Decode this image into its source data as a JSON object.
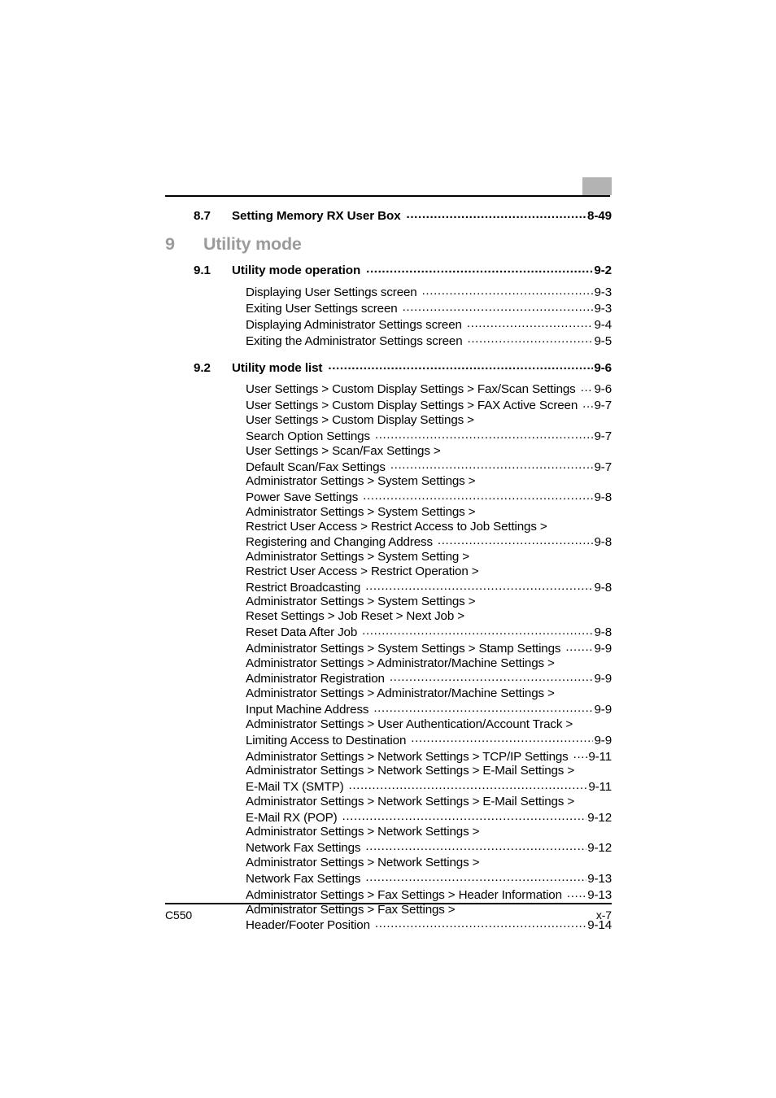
{
  "document": {
    "footer_left": "C550",
    "footer_right": "x-7",
    "tab_color": "#b3b3b3",
    "chapter_heading_color": "#9b9b9b"
  },
  "toc": {
    "prev_chapter_entry": {
      "number": "8.7",
      "label": "Setting Memory RX User Box",
      "page": "8-49"
    },
    "chapter": {
      "number": "9",
      "title": "Utility mode"
    },
    "sections": [
      {
        "number": "9.1",
        "label": "Utility mode operation",
        "page": "9-2",
        "entries": [
          {
            "lines": [
              "Displaying User Settings screen"
            ],
            "page": "9-3"
          },
          {
            "lines": [
              "Exiting User Settings screen"
            ],
            "page": "9-3"
          },
          {
            "lines": [
              "Displaying Administrator Settings screen"
            ],
            "page": "9-4"
          },
          {
            "lines": [
              "Exiting the Administrator Settings screen"
            ],
            "page": "9-5"
          }
        ]
      },
      {
        "number": "9.2",
        "label": "Utility mode list",
        "page": "9-6",
        "entries": [
          {
            "lines": [
              "User Settings > Custom Display Settings > Fax/Scan Settings"
            ],
            "page": "9-6"
          },
          {
            "lines": [
              "User Settings > Custom Display Settings > FAX Active Screen"
            ],
            "page": "9-7"
          },
          {
            "lines": [
              "User Settings > Custom Display Settings >",
              "Search Option Settings"
            ],
            "page": "9-7"
          },
          {
            "lines": [
              "User Settings > Scan/Fax Settings >",
              "Default Scan/Fax Settings"
            ],
            "page": "9-7"
          },
          {
            "lines": [
              "Administrator Settings > System Settings >",
              "Power Save Settings"
            ],
            "page": "9-8"
          },
          {
            "lines": [
              "Administrator Settings > System Settings >",
              "Restrict User Access > Restrict Access to Job Settings >",
              "Registering and Changing Address"
            ],
            "page": "9-8"
          },
          {
            "lines": [
              "Administrator Settings > System Setting >",
              "Restrict User Access > Restrict Operation >",
              "Restrict Broadcasting"
            ],
            "page": "9-8"
          },
          {
            "lines": [
              "Administrator Settings > System Settings >",
              "Reset Settings > Job Reset > Next Job >",
              "Reset Data After Job"
            ],
            "page": "9-8"
          },
          {
            "lines": [
              "Administrator Settings > System Settings > Stamp Settings"
            ],
            "page": "9-9"
          },
          {
            "lines": [
              "Administrator Settings > Administrator/Machine Settings >",
              "Administrator Registration"
            ],
            "page": "9-9"
          },
          {
            "lines": [
              "Administrator Settings > Administrator/Machine Settings >",
              "Input Machine Address"
            ],
            "page": "9-9"
          },
          {
            "lines": [
              "Administrator Settings > User Authentication/Account Track >",
              "Limiting Access to Destination"
            ],
            "page": "9-9"
          },
          {
            "lines": [
              "Administrator Settings > Network Settings > TCP/IP Settings"
            ],
            "page": "9-11"
          },
          {
            "lines": [
              "Administrator Settings > Network Settings > E-Mail Settings >",
              "E-Mail TX (SMTP)"
            ],
            "page": "9-11"
          },
          {
            "lines": [
              "Administrator Settings > Network Settings > E-Mail Settings >",
              "E-Mail RX (POP)"
            ],
            "page": "9-12"
          },
          {
            "lines": [
              "Administrator Settings > Network Settings >",
              "Network Fax Settings"
            ],
            "page": "9-12"
          },
          {
            "lines": [
              "Administrator Settings > Network Settings >",
              "Network Fax Settings"
            ],
            "page": "9-13"
          },
          {
            "lines": [
              "Administrator Settings > Fax Settings > Header Information"
            ],
            "page": "9-13"
          },
          {
            "lines": [
              "Administrator Settings > Fax Settings >",
              "Header/Footer Position"
            ],
            "page": "9-14"
          }
        ]
      }
    ]
  }
}
